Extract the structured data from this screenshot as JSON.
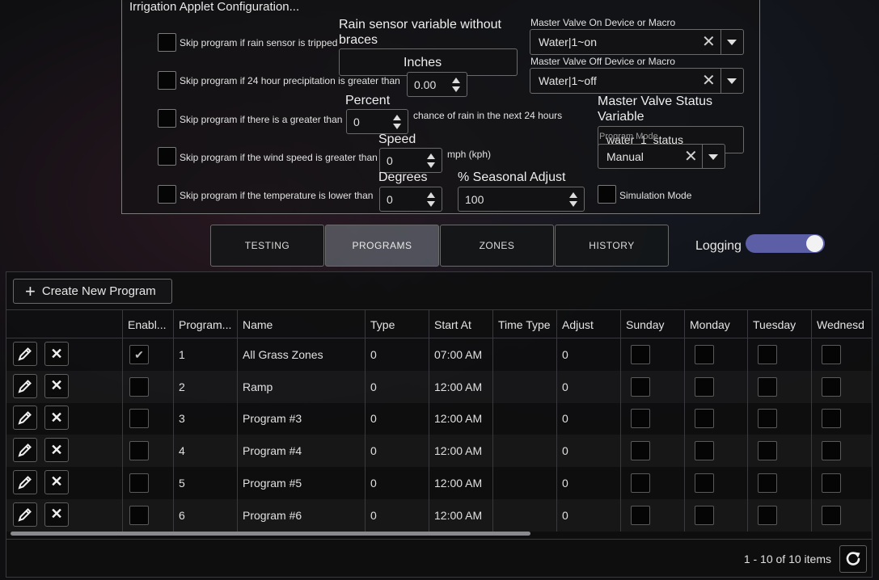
{
  "config": {
    "title": "Irrigation Applet Configuration...",
    "skip_rain_sensor": {
      "label": "Skip program if rain sensor is tripped",
      "checked": false
    },
    "rain_sensor_var": {
      "label_line1": "Rain sensor variable without",
      "label_line2": "braces",
      "value": ""
    },
    "skip_precip": {
      "label": "Skip program if 24 hour precipitation is greater than",
      "checked": false,
      "unit_label": "Inches",
      "value": "0.00"
    },
    "skip_chance": {
      "label": "Skip program if there is a greater than",
      "checked": false,
      "unit_label": "Percent",
      "value": "0",
      "suffix": "chance of rain in the next 24 hours"
    },
    "skip_wind": {
      "label": "Skip program if the wind speed is greater than",
      "checked": false,
      "unit_label": "Speed",
      "value": "0",
      "suffix": "mph (kph)"
    },
    "skip_temp": {
      "label": "Skip program if the temperature is lower than",
      "checked": false,
      "unit_label": "Degrees",
      "value": "0"
    },
    "seasonal": {
      "label": "% Seasonal Adjust",
      "value": "100"
    },
    "master_on": {
      "label": "Master Valve On Device or Macro",
      "value": "Water|1~on"
    },
    "master_off": {
      "label": "Master Valve Off Device or Macro",
      "value": "Water|1~off"
    },
    "master_status": {
      "label_line1": "Master Valve Status",
      "label_line2": "Variable",
      "value": "water_1_status"
    },
    "program_mode": {
      "label": "Program Mode",
      "value": "Manual"
    },
    "simulation": {
      "label": "Simulation Mode",
      "checked": false
    }
  },
  "tabs": [
    {
      "label": "TESTING",
      "active": false
    },
    {
      "label": "PROGRAMS",
      "active": true
    },
    {
      "label": "ZONES",
      "active": false
    },
    {
      "label": "HISTORY",
      "active": false
    }
  ],
  "logging": {
    "label": "Logging",
    "on": true
  },
  "grid": {
    "create_label": "Create New Program",
    "columns": [
      "Enabl...",
      "Program...",
      "Name",
      "Type",
      "Start At",
      "Time Type",
      "Adjust",
      "Sunday",
      "Monday",
      "Tuesday",
      "Wednesd"
    ],
    "rows": [
      {
        "enabled": true,
        "program": "1",
        "name": "All Grass Zones",
        "type": "0",
        "start": "07:00 AM",
        "time_type": "",
        "adjust": "0"
      },
      {
        "enabled": false,
        "program": "2",
        "name": "Ramp",
        "type": "0",
        "start": "12:00 AM",
        "time_type": "",
        "adjust": "0"
      },
      {
        "enabled": false,
        "program": "3",
        "name": "Program #3",
        "type": "0",
        "start": "12:00 AM",
        "time_type": "",
        "adjust": "0"
      },
      {
        "enabled": false,
        "program": "4",
        "name": "Program #4",
        "type": "0",
        "start": "12:00 AM",
        "time_type": "",
        "adjust": "0"
      },
      {
        "enabled": false,
        "program": "5",
        "name": "Program #5",
        "type": "0",
        "start": "12:00 AM",
        "time_type": "",
        "adjust": "0"
      },
      {
        "enabled": false,
        "program": "6",
        "name": "Program #6",
        "type": "0",
        "start": "12:00 AM",
        "time_type": "",
        "adjust": "0"
      }
    ],
    "pager_info": "1 - 10 of 10 items",
    "icons": {
      "edit": "pencil-icon",
      "delete": "close-icon",
      "refresh": "refresh-icon",
      "add": "plus-icon"
    }
  }
}
